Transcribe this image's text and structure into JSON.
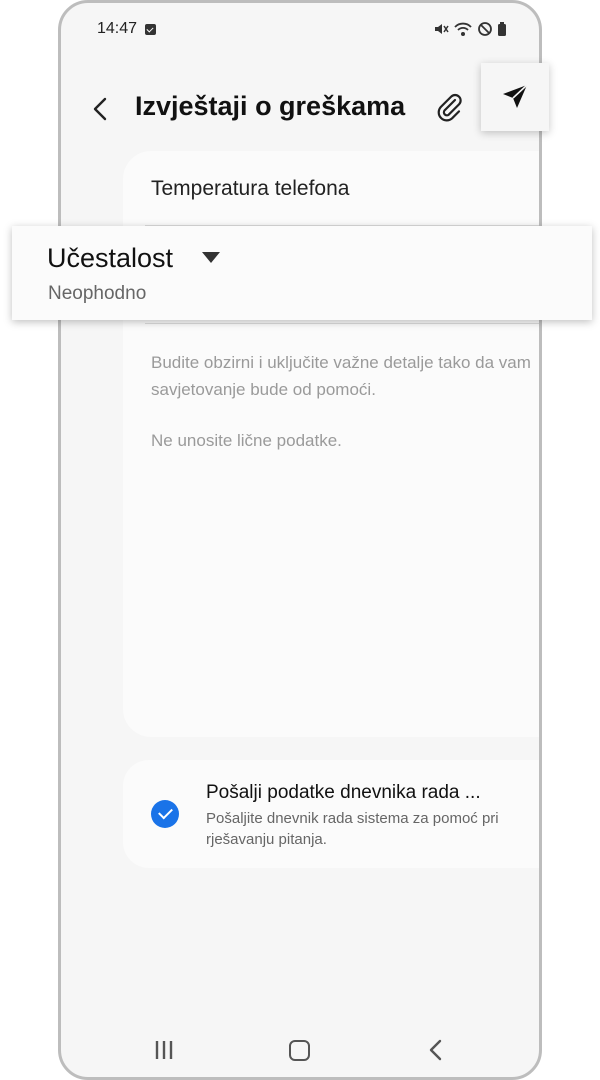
{
  "status": {
    "time": "14:47"
  },
  "header": {
    "title": "Izvještaji o greškama"
  },
  "form": {
    "subject": "Temperatura telefona",
    "hint_line1": "Budite obzirni i uključite važne detalje tako da vam savjetovanje bude od pomoći.",
    "hint_line2": "Ne unosite lične podatke."
  },
  "frequency_popup": {
    "label": "Učestalost",
    "value": "Neophodno"
  },
  "log_option": {
    "title": "Pošalji podatke dnevnika rada ...",
    "description": "Pošaljite dnevnik rada sistema za pomoć pri rješavanju pitanja.",
    "checked": true
  },
  "colors": {
    "accent": "#1a73e8",
    "background": "#f6f6f6",
    "card": "#fbfbfb"
  },
  "icons": [
    "check-notification-icon",
    "mute-icon",
    "wifi-icon",
    "no-disturb-icon",
    "battery-icon",
    "back-icon",
    "attach-icon",
    "send-icon",
    "chevron-down-icon",
    "nav-recent-icon",
    "nav-home-icon",
    "nav-back-icon"
  ]
}
